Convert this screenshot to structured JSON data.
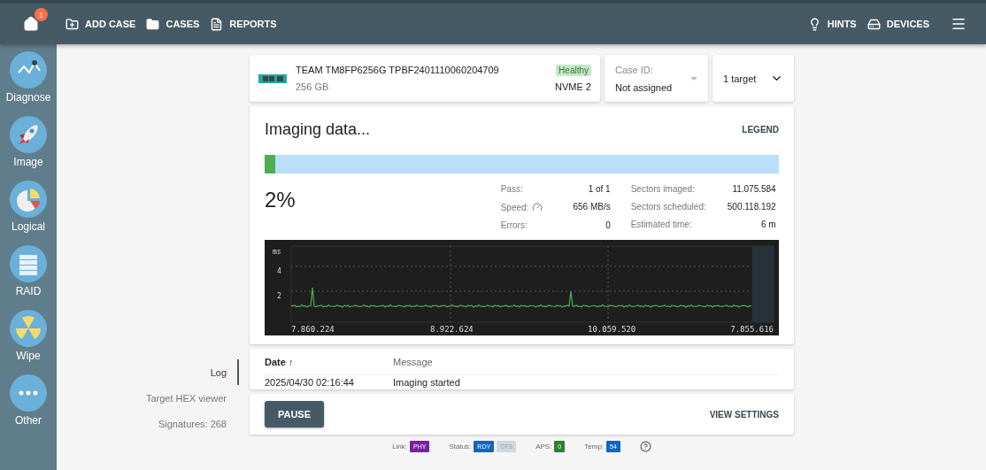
{
  "topbar": {
    "home_badge": "1",
    "left_actions": [
      {
        "label": "ADD CASE"
      },
      {
        "label": "CASES"
      },
      {
        "label": "REPORTS"
      }
    ],
    "right_actions": [
      {
        "label": "HINTS"
      },
      {
        "label": "DEVICES"
      }
    ]
  },
  "sidebar": {
    "items": [
      {
        "label": "Diagnose"
      },
      {
        "label": "Image"
      },
      {
        "label": "Logical"
      },
      {
        "label": "RAID"
      },
      {
        "label": "Wipe"
      },
      {
        "label": "Other"
      }
    ]
  },
  "device": {
    "name": "TEAM TM8FP6256G TPBF2401110060204709",
    "size": "256 GB",
    "health": "Healthy",
    "port": "NVME 2"
  },
  "case": {
    "label": "Case ID:",
    "value": "Not assigned"
  },
  "targets": {
    "label": "1 target"
  },
  "task": {
    "title": "Imaging data...",
    "legend": "LEGEND",
    "level": 0.02,
    "percent": "2%",
    "stats": [
      {
        "label": "Pass:",
        "value": "1 of 1"
      },
      {
        "label": "Speed:",
        "value": "656 MB/s"
      },
      {
        "label": "Errors:",
        "value": "0"
      }
    ],
    "stats2": [
      {
        "label": "Sectors imaged:",
        "value": "11.075.584"
      },
      {
        "label": "Sectors scheduled:",
        "value": "500.118.192"
      },
      {
        "label": "Estimated time:",
        "value": "6 m"
      }
    ],
    "graph": {
      "unit": "ms",
      "y_labels": [
        "4",
        "2"
      ],
      "x_labels": [
        "7.860.224",
        "8.922.624",
        "10.059.520",
        "7.855.616"
      ]
    }
  },
  "side_tabs": [
    {
      "label": "Log",
      "selected": true
    },
    {
      "label": "Target HEX viewer",
      "selected": false
    },
    {
      "label": "Signatures: 268",
      "selected": false
    }
  ],
  "log": {
    "columns": [
      "Date ↑",
      "Message"
    ],
    "rows": [
      [
        "2025/04/30 02:16:44",
        "Imaging started"
      ]
    ]
  },
  "actions": {
    "primary": "PAUSE",
    "secondary": "VIEW SETTINGS"
  },
  "status_bar": [
    {
      "label": "Link:",
      "badges": [
        {
          "text": "PHY",
          "color": "#7b1fa2"
        }
      ]
    },
    {
      "label": "Status:",
      "badges": [
        {
          "text": "RDY",
          "color": "#1565c0"
        },
        {
          "text": "CFS",
          "color": "#cfd8dc"
        }
      ]
    },
    {
      "label": "APS:",
      "badges": [
        {
          "text": "0",
          "color": "#2e7d32"
        }
      ]
    },
    {
      "label": "Temp:",
      "badges": [
        {
          "text": "54",
          "color": "#1565c0"
        }
      ]
    }
  ]
}
